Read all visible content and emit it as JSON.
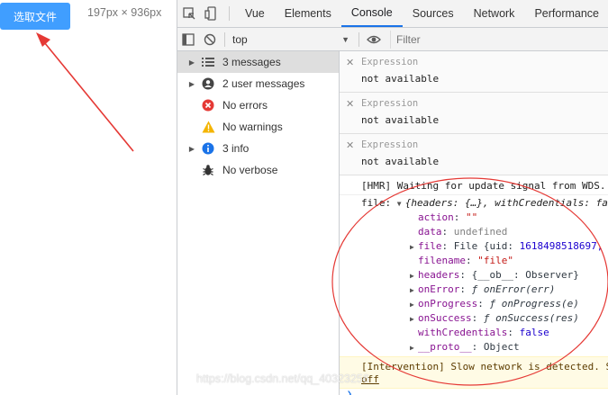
{
  "app": {
    "upload_button": "选取文件",
    "viewport_size": "197px × 936px"
  },
  "tabs": [
    {
      "label": "Vue"
    },
    {
      "label": "Elements"
    },
    {
      "label": "Console",
      "active": true
    },
    {
      "label": "Sources"
    },
    {
      "label": "Network"
    },
    {
      "label": "Performance"
    }
  ],
  "toolbar": {
    "context": "top",
    "filter_placeholder": "Filter"
  },
  "sidebar": {
    "items": [
      {
        "label": "3 messages",
        "icon": "list-icon"
      },
      {
        "label": "2 user messages",
        "icon": "user-icon"
      },
      {
        "label": "No errors",
        "icon": "error-icon"
      },
      {
        "label": "No warnings",
        "icon": "warning-icon"
      },
      {
        "label": "3 info",
        "icon": "info-icon"
      },
      {
        "label": "No verbose",
        "icon": "bug-icon"
      }
    ]
  },
  "console": {
    "expressions": [
      {
        "label": "Expression",
        "value": "not available"
      },
      {
        "label": "Expression",
        "value": "not available"
      },
      {
        "label": "Expression",
        "value": "not available"
      }
    ],
    "hmr": "[HMR] Waiting for update signal from WDS...",
    "file_prefix": "file:",
    "file_summary": "{headers: {…}, withCredentials: fa",
    "props": [
      {
        "key": "action",
        "sep": ": ",
        "value": "\"\"",
        "kind": "str",
        "expandable": false
      },
      {
        "key": "data",
        "sep": ": ",
        "value": "undefined",
        "kind": "gray",
        "expandable": false
      },
      {
        "key": "file",
        "sep": ": ",
        "value": "File {uid: ",
        "value2": "1618498518697,",
        "kind": "file",
        "expandable": true
      },
      {
        "key": "filename",
        "sep": ": ",
        "value": "\"file\"",
        "kind": "str",
        "expandable": false
      },
      {
        "key": "headers",
        "sep": ": ",
        "value": "{__ob__: Observer}",
        "kind": "plain",
        "expandable": true
      },
      {
        "key": "onError",
        "sep": ": ",
        "value": "ƒ onError(err)",
        "kind": "fn",
        "expandable": true
      },
      {
        "key": "onProgress",
        "sep": ": ",
        "value": "ƒ onProgress(e)",
        "kind": "fn",
        "expandable": true
      },
      {
        "key": "onSuccess",
        "sep": ": ",
        "value": "ƒ onSuccess(res)",
        "kind": "fn",
        "expandable": true
      },
      {
        "key": "withCredentials",
        "sep": ": ",
        "value": "false",
        "kind": "bool",
        "expandable": false
      },
      {
        "key": "__proto__",
        "sep": ": ",
        "value": "Object",
        "kind": "plain",
        "expandable": true
      }
    ],
    "intervention_line1": "[Intervention] Slow network is detected. S",
    "intervention_line2": "off",
    "watermark": "https://blog.csdn.net/qq_40323256"
  },
  "colors": {
    "accent": "#409eff",
    "annotation": "#e53935",
    "active_tab": "#1a73e8"
  }
}
